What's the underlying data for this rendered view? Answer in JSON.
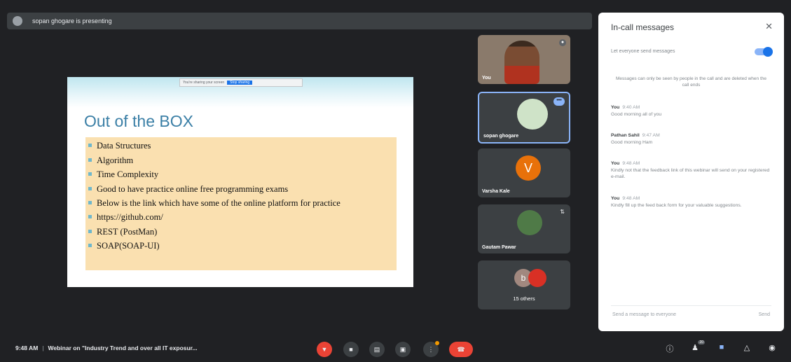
{
  "presenter_bar": {
    "text": "sopan ghogare is presenting"
  },
  "slide": {
    "share_notice": "You're sharing your screen",
    "stop_label": "Stop sharing",
    "title": "Out of the BOX",
    "bullets": [
      "Data Structures",
      "Algorithm",
      "Time Complexity",
      "Good to have practice online free programming exams",
      "Below is the link which have some of the online platform for practice",
      "https://github.com/",
      "REST (PostMan)",
      "SOAP(SOAP-UI)"
    ]
  },
  "tiles": {
    "you": "You",
    "sopan": "sopan ghogare",
    "varsha": "Varsha Kale",
    "varsha_initial": "V",
    "gautam": "Gautam Pawar",
    "others_initial": "b",
    "others": "15 others"
  },
  "panel": {
    "title": "In-call messages",
    "toggle_label": "Let everyone send messages",
    "note": "Messages can only be seen by people in the call and are deleted when the call ends",
    "messages": [
      {
        "who": "You",
        "time": "9:40 AM",
        "text": "Good morning all of you"
      },
      {
        "who": "Pathan Sahil",
        "time": "9:47 AM",
        "text": "Good morning Ham"
      },
      {
        "who": "You",
        "time": "9:48 AM",
        "text": "Kindly not that the feedback link of this webinar will send on your registered e-mail."
      },
      {
        "who": "You",
        "time": "9:48 AM",
        "text": "Kindly fill up the feed back form for your valuable suggestions."
      }
    ],
    "input_placeholder": "Send a message to everyone",
    "send": "Send"
  },
  "bottom": {
    "time": "9:48 AM",
    "meeting": "Webinar on \"Industry Trend and over all IT exposur...",
    "people_count": "20"
  },
  "colors": {
    "accent": "#1a73e8",
    "end_call": "#ea4335",
    "bg": "#202124"
  }
}
